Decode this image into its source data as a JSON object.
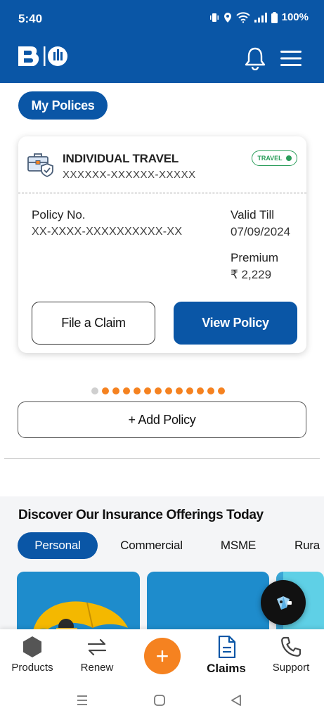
{
  "status_bar": {
    "time": "5:40",
    "battery": "100%"
  },
  "header": {
    "logo": "BI",
    "notification_icon": "bell-icon",
    "menu_icon": "hamburger-menu-icon"
  },
  "policies": {
    "section_label": "My Polices",
    "card": {
      "product_name": "INDIVIDUAL TRAVEL",
      "masked_id": "XXXXXX-XXXXXX-XXXXX",
      "badge": "TRAVEL",
      "policy_no_label": "Policy No.",
      "policy_no_value": "XX-XXXX-XXXXXXXXXX-XX",
      "valid_till_label": "Valid Till",
      "valid_till_value": "07/09/2024",
      "premium_label": "Premium",
      "premium_value": "₹ 2,229",
      "file_claim_label": "File a Claim",
      "view_policy_label": "View Policy"
    },
    "add_policy_label": "+ Add Policy"
  },
  "discover": {
    "heading": "Discover Our Insurance Offerings Today",
    "tabs": [
      {
        "label": "Personal",
        "active": true
      },
      {
        "label": "Commercial",
        "active": false
      },
      {
        "label": "MSME",
        "active": false
      },
      {
        "label": "Rura",
        "active": false
      }
    ]
  },
  "bottom_nav": {
    "items": [
      {
        "label": "Products",
        "icon": "hexagon-icon"
      },
      {
        "label": "Renew",
        "icon": "renew-arrows-icon"
      },
      {
        "label": "",
        "icon": "plus-icon"
      },
      {
        "label": "Claims",
        "icon": "document-icon"
      },
      {
        "label": "Support",
        "icon": "phone-icon"
      }
    ]
  },
  "colors": {
    "brand_blue": "#0a56a6",
    "accent_orange": "#f58220",
    "badge_green": "#2a9d5a"
  }
}
